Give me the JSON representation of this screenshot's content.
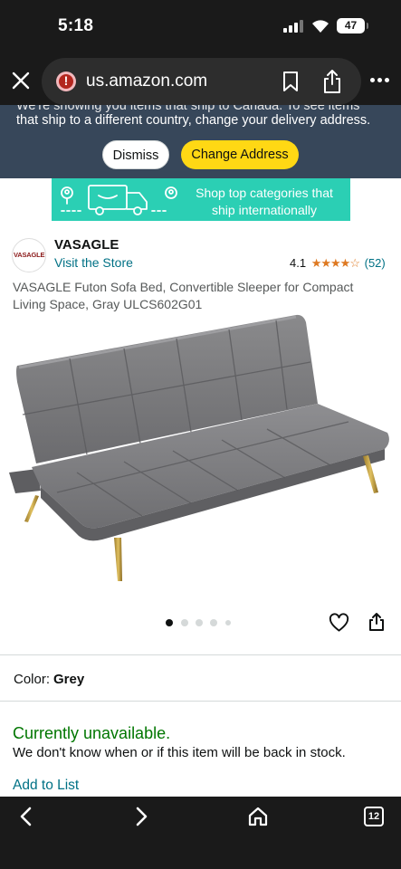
{
  "status_bar": {
    "time": "5:18",
    "battery": "47"
  },
  "browser": {
    "url": "us.amazon.com"
  },
  "shipping_banner": {
    "message_line1": "We're showing you items that ship to Canada. To see items",
    "message_line2": "that ship to a different country, change your delivery address.",
    "dismiss_label": "Dismiss",
    "change_address_label": "Change Address"
  },
  "intl_banner": {
    "text": "Shop top categories that ship internationally"
  },
  "brand": {
    "logo_text": "VASAGLE",
    "name": "VASAGLE",
    "visit_store": "Visit the Store"
  },
  "rating": {
    "value": "4.1",
    "stars": "★★★★☆",
    "count": "(52)"
  },
  "product": {
    "title": "VASAGLE Futon Sofa Bed, Convertible Sleeper for Compact Living Space, Gray ULCS602G01"
  },
  "carousel": {
    "total": 5,
    "active_index": 0
  },
  "variant": {
    "color_label": "Color:",
    "color_value": "Grey"
  },
  "availability": {
    "status": "Currently unavailable.",
    "detail": "We don't know when or if this item will be back in stock."
  },
  "actions": {
    "add_to_list": "Add to List"
  },
  "toolbar": {
    "tab_count": "12"
  },
  "colors": {
    "amazon_link": "#007185",
    "unavailable_green": "#007600",
    "change_address_yellow": "#ffd814",
    "banner_navy": "#37475a",
    "intl_banner_teal": "#2bcfb4",
    "star_orange": "#de7921"
  }
}
